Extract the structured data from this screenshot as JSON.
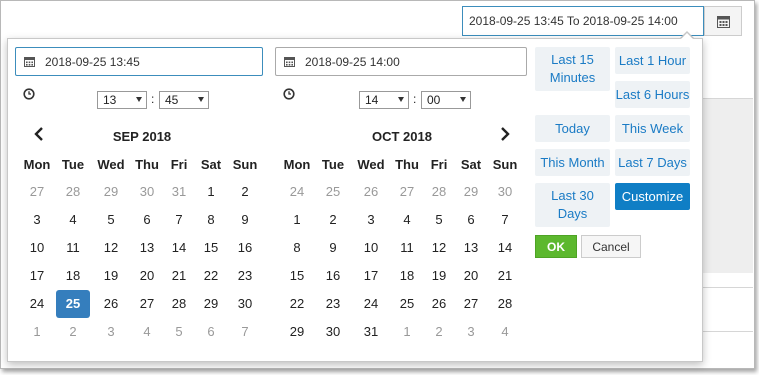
{
  "header": {
    "range_value": "2018-09-25 13:45 To 2018-09-25 14:00",
    "calendar_button_icon": "calendar-icon"
  },
  "start": {
    "date_value": "2018-09-25 13:45",
    "hour": "13",
    "minute": "45"
  },
  "end": {
    "date_value": "2018-09-25 14:00",
    "hour": "14",
    "minute": "00"
  },
  "calendars": [
    {
      "title": "SEP 2018",
      "weekdays": [
        "Mon",
        "Tue",
        "Wed",
        "Thu",
        "Fri",
        "Sat",
        "Sun"
      ],
      "weeks": [
        [
          "27",
          "28",
          "29",
          "30",
          "31",
          "1",
          "2"
        ],
        [
          "3",
          "4",
          "5",
          "6",
          "7",
          "8",
          "9"
        ],
        [
          "10",
          "11",
          "12",
          "13",
          "14",
          "15",
          "16"
        ],
        [
          "17",
          "18",
          "19",
          "20",
          "21",
          "22",
          "23"
        ],
        [
          "24",
          "25",
          "26",
          "27",
          "28",
          "29",
          "30"
        ],
        [
          "1",
          "2",
          "3",
          "4",
          "5",
          "6",
          "7"
        ]
      ],
      "off": [
        [
          0,
          0
        ],
        [
          0,
          1
        ],
        [
          0,
          2
        ],
        [
          0,
          3
        ],
        [
          0,
          4
        ],
        [
          5,
          0
        ],
        [
          5,
          1
        ],
        [
          5,
          2
        ],
        [
          5,
          3
        ],
        [
          5,
          4
        ],
        [
          5,
          5
        ],
        [
          5,
          6
        ]
      ],
      "selected": [
        4,
        1
      ]
    },
    {
      "title": "OCT 2018",
      "weekdays": [
        "Mon",
        "Tue",
        "Wed",
        "Thu",
        "Fri",
        "Sat",
        "Sun"
      ],
      "weeks": [
        [
          "24",
          "25",
          "26",
          "27",
          "28",
          "29",
          "30"
        ],
        [
          "1",
          "2",
          "3",
          "4",
          "5",
          "6",
          "7"
        ],
        [
          "8",
          "9",
          "10",
          "11",
          "12",
          "13",
          "14"
        ],
        [
          "15",
          "16",
          "17",
          "18",
          "19",
          "20",
          "21"
        ],
        [
          "22",
          "23",
          "24",
          "25",
          "26",
          "27",
          "28"
        ],
        [
          "29",
          "30",
          "31",
          "1",
          "2",
          "3",
          "4"
        ]
      ],
      "off": [
        [
          0,
          0
        ],
        [
          0,
          1
        ],
        [
          0,
          2
        ],
        [
          0,
          3
        ],
        [
          0,
          4
        ],
        [
          0,
          5
        ],
        [
          0,
          6
        ],
        [
          5,
          3
        ],
        [
          5,
          4
        ],
        [
          5,
          5
        ],
        [
          5,
          6
        ]
      ],
      "selected": null
    }
  ],
  "ranges": [
    {
      "label": "Last 15 Minutes",
      "active": false
    },
    {
      "label": "Last 1 Hour",
      "active": false
    },
    {
      "label": "Last 6 Hours",
      "active": false
    },
    {
      "label": "Today",
      "active": false
    },
    {
      "label": "This Week",
      "active": false
    },
    {
      "label": "This Month",
      "active": false
    },
    {
      "label": "Last 7 Days",
      "active": false
    },
    {
      "label": "Last 30 Days",
      "active": false
    },
    {
      "label": "Customize",
      "active": true
    }
  ],
  "actions": {
    "ok_label": "OK",
    "cancel_label": "Cancel"
  },
  "colors": {
    "accent": "#357ebd",
    "ok_green": "#5cb82e",
    "active_range": "#0f7ec5",
    "range_text": "#1a7bc5"
  }
}
